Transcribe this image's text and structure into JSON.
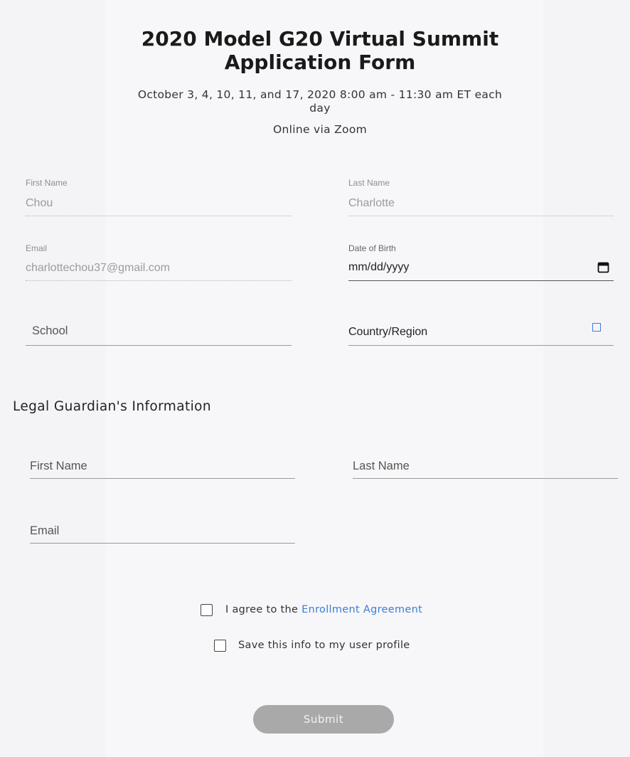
{
  "header": {
    "title_line1": "2020 Model G20 Virtual Summit",
    "title_line2": "Application Form",
    "dates_line1": "October 3, 4, 10, 11, and 17, 2020 8:00 am - 11:30 am ET each",
    "dates_line2": "day",
    "location": "Online via Zoom"
  },
  "applicant": {
    "first_name": {
      "label": "First Name",
      "value": "Chou"
    },
    "last_name": {
      "label": "Last Name",
      "value": "Charlotte"
    },
    "email": {
      "label": "Email",
      "value": "charlottechou37@gmail.com"
    },
    "dob": {
      "label": "Date of Birth",
      "value": "mm/dd/yyyy"
    },
    "school": {
      "placeholder": "School"
    },
    "country": {
      "placeholder": "Country/Region"
    }
  },
  "guardian": {
    "heading": "Legal Guardian's Information",
    "first_name_placeholder": "First Name",
    "last_name_placeholder": "Last Name",
    "email_placeholder": "Email"
  },
  "agreements": {
    "agree_prefix": "I agree to the ",
    "agree_link": "Enrollment Agreement",
    "save_profile": "Save this info to my user profile"
  },
  "submit_label": "Submit",
  "colors": {
    "link": "#3d7dd8",
    "submit_bg": "#a9a9a9",
    "page_bg": "#f4f4f6"
  }
}
